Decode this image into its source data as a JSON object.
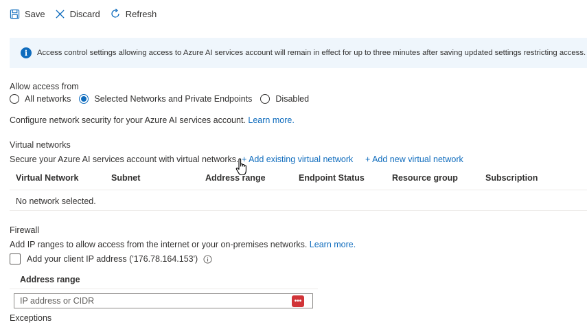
{
  "toolbar": {
    "save": "Save",
    "discard": "Discard",
    "refresh": "Refresh"
  },
  "info_banner": {
    "text": "Access control settings allowing access to Azure AI services account will remain in effect for up to three minutes after saving updated settings restricting access."
  },
  "allow_access": {
    "label": "Allow access from",
    "options": [
      "All networks",
      "Selected Networks and Private Endpoints",
      "Disabled"
    ],
    "selected": "Selected Networks and Private Endpoints"
  },
  "configure": {
    "text": "Configure network security for your Azure AI services account.",
    "link": "Learn more."
  },
  "virtual_networks": {
    "heading": "Virtual networks",
    "description": "Secure your Azure AI services account with virtual networks.",
    "add_existing": "+ Add existing virtual network",
    "add_new": "+ Add new virtual network",
    "columns": [
      "Virtual Network",
      "Subnet",
      "Address range",
      "Endpoint Status",
      "Resource group",
      "Subscription"
    ],
    "empty_text": "No network selected."
  },
  "firewall": {
    "heading": "Firewall",
    "description": "Add IP ranges to allow access from the internet or your on-premises networks.",
    "link": "Learn more.",
    "client_ip_label": "Add your client IP address ('176.78.164.153')",
    "address_range_header": "Address range",
    "input_placeholder": "IP address or CIDR"
  },
  "exceptions": {
    "heading": "Exceptions"
  },
  "colors": {
    "accent": "#0f6cbd",
    "info_bg": "#eff6fc",
    "error_button": "#d13438"
  }
}
